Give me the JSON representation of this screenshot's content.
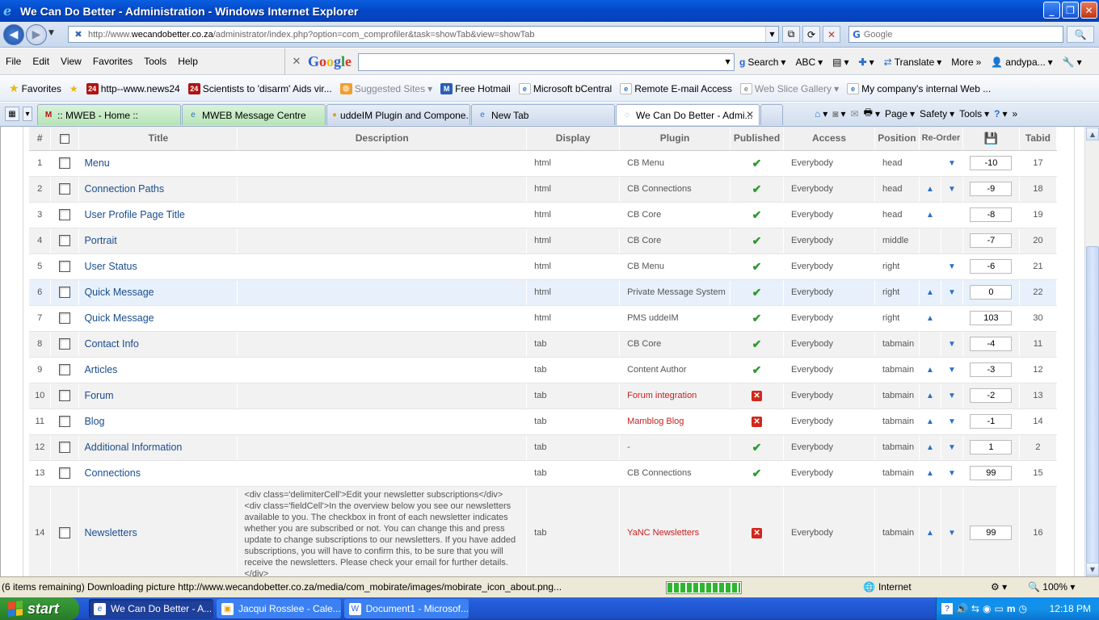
{
  "window": {
    "title": "We Can Do Better - Administration - Windows Internet Explorer",
    "minimize": "_",
    "maximize": "❐",
    "close": "✕"
  },
  "address": {
    "url_prefix": "http://www.",
    "url_domain": "wecandobetter.co.za",
    "url_path": "/administrator/index.php?option=com_comprofiler&task=showTab&view=showTab",
    "search_placeholder": "Google"
  },
  "menu": {
    "items": [
      "File",
      "Edit",
      "View",
      "Favorites",
      "Tools",
      "Help"
    ]
  },
  "googlebar": {
    "search_label": "Search",
    "translate_label": "Translate",
    "more_label": "More",
    "user_label": "andypa..."
  },
  "favorites": {
    "label": "Favorites",
    "links": [
      "http--www.news24",
      "Scientists to 'disarm' Aids vir...",
      "Suggested Sites",
      "Free Hotmail",
      "Microsoft bCentral",
      "Remote E-mail Access",
      "Web Slice Gallery",
      "My company's internal Web ..."
    ]
  },
  "tabs": [
    {
      "label": ":: MWEB - Home ::"
    },
    {
      "label": "MWEB Message Centre"
    },
    {
      "label": "uddeIM Plugin and Compone..."
    },
    {
      "label": "New Tab"
    },
    {
      "label": "We Can Do Better - Admi..."
    }
  ],
  "commandbar": {
    "page": "Page",
    "safety": "Safety",
    "tools": "Tools"
  },
  "table": {
    "headers": {
      "num": "#",
      "title": "Title",
      "description": "Description",
      "display": "Display",
      "plugin": "Plugin",
      "published": "Published",
      "access": "Access",
      "position": "Position",
      "reorder": "Re-Order",
      "tabid": "Tabid"
    },
    "rows": [
      {
        "num": "1",
        "title": "Menu",
        "description": "",
        "display": "html",
        "plugin": "CB Menu",
        "published": true,
        "access": "Everybody",
        "position": "head",
        "up": false,
        "down": true,
        "order": "-10",
        "tabid": "17"
      },
      {
        "num": "2",
        "title": "Connection Paths",
        "description": "",
        "display": "html",
        "plugin": "CB Connections",
        "published": true,
        "access": "Everybody",
        "position": "head",
        "up": true,
        "down": true,
        "order": "-9",
        "tabid": "18"
      },
      {
        "num": "3",
        "title": "User Profile Page Title",
        "description": "",
        "display": "html",
        "plugin": "CB Core",
        "published": true,
        "access": "Everybody",
        "position": "head",
        "up": true,
        "down": false,
        "order": "-8",
        "tabid": "19"
      },
      {
        "num": "4",
        "title": "Portrait",
        "description": "",
        "display": "html",
        "plugin": "CB Core",
        "published": true,
        "access": "Everybody",
        "position": "middle",
        "up": false,
        "down": false,
        "order": "-7",
        "tabid": "20"
      },
      {
        "num": "5",
        "title": "User Status",
        "description": "",
        "display": "html",
        "plugin": "CB Menu",
        "published": true,
        "access": "Everybody",
        "position": "right",
        "up": false,
        "down": true,
        "order": "-6",
        "tabid": "21"
      },
      {
        "num": "6",
        "title": "Quick Message",
        "description": "",
        "display": "html",
        "plugin": "Private Message System",
        "published": true,
        "access": "Everybody",
        "position": "right",
        "up": true,
        "down": true,
        "order": "0",
        "tabid": "22"
      },
      {
        "num": "7",
        "title": "Quick Message",
        "description": "",
        "display": "html",
        "plugin": "PMS uddeIM",
        "published": true,
        "access": "Everybody",
        "position": "right",
        "up": true,
        "down": false,
        "order": "103",
        "tabid": "30"
      },
      {
        "num": "8",
        "title": "Contact Info",
        "description": "",
        "display": "tab",
        "plugin": "CB Core",
        "published": true,
        "access": "Everybody",
        "position": "tabmain",
        "up": false,
        "down": true,
        "order": "-4",
        "tabid": "11"
      },
      {
        "num": "9",
        "title": "Articles",
        "description": "",
        "display": "tab",
        "plugin": "Content Author",
        "published": true,
        "access": "Everybody",
        "position": "tabmain",
        "up": true,
        "down": true,
        "order": "-3",
        "tabid": "12"
      },
      {
        "num": "10",
        "title": "Forum",
        "description": "",
        "display": "tab",
        "plugin": "Forum integration",
        "plugin_red": true,
        "published": false,
        "access": "Everybody",
        "position": "tabmain",
        "up": true,
        "down": true,
        "order": "-2",
        "tabid": "13"
      },
      {
        "num": "11",
        "title": "Blog",
        "description": "",
        "display": "tab",
        "plugin": "Mamblog Blog",
        "plugin_red": true,
        "published": false,
        "access": "Everybody",
        "position": "tabmain",
        "up": true,
        "down": true,
        "order": "-1",
        "tabid": "14"
      },
      {
        "num": "12",
        "title": "Additional Information",
        "description": "",
        "display": "tab",
        "plugin": "-",
        "published": true,
        "access": "Everybody",
        "position": "tabmain",
        "up": true,
        "down": true,
        "order": "1",
        "tabid": "2"
      },
      {
        "num": "13",
        "title": "Connections",
        "description": "",
        "display": "tab",
        "plugin": "CB Connections",
        "published": true,
        "access": "Everybody",
        "position": "tabmain",
        "up": true,
        "down": true,
        "order": "99",
        "tabid": "15"
      },
      {
        "num": "14",
        "title": "Newsletters",
        "description": "<div class='delimiterCell'>Edit your newsletter subscriptions</div> <div class='fieldCell'>In the overview below you see our newsletters available to you. The checkbox in front of each newsletter indicates whether you are subscribed or not. You can change this and press update to change subscriptions to our newsletters. If you have added subscriptions, you will have to confirm this, to be sure that you will receive the newsletters. Please check your email for further details.</div>",
        "display": "tab",
        "plugin": "YaNC Newsletters",
        "plugin_red": true,
        "published": false,
        "access": "Everybody",
        "position": "tabmain",
        "up": true,
        "down": true,
        "order": "99",
        "tabid": "16"
      }
    ]
  },
  "status": {
    "text": "(6 items remaining) Downloading picture http://www.wecandobetter.co.za/media/com_mobirate/images/mobirate_icon_about.png...",
    "progress": 1.0,
    "zone": "Internet",
    "zoom": "100%"
  },
  "taskbar": {
    "start": "start",
    "buttons": [
      {
        "label": "We Can Do Better - A..."
      },
      {
        "label": "Jacqui Rosslee - Cale..."
      },
      {
        "label": "Document1 - Microsof..."
      }
    ],
    "clock": "12:18 PM"
  },
  "colors": {
    "title_link": "#1a4d8f",
    "access_green": "#1d8a1d",
    "plugin_red": "#c82020"
  }
}
